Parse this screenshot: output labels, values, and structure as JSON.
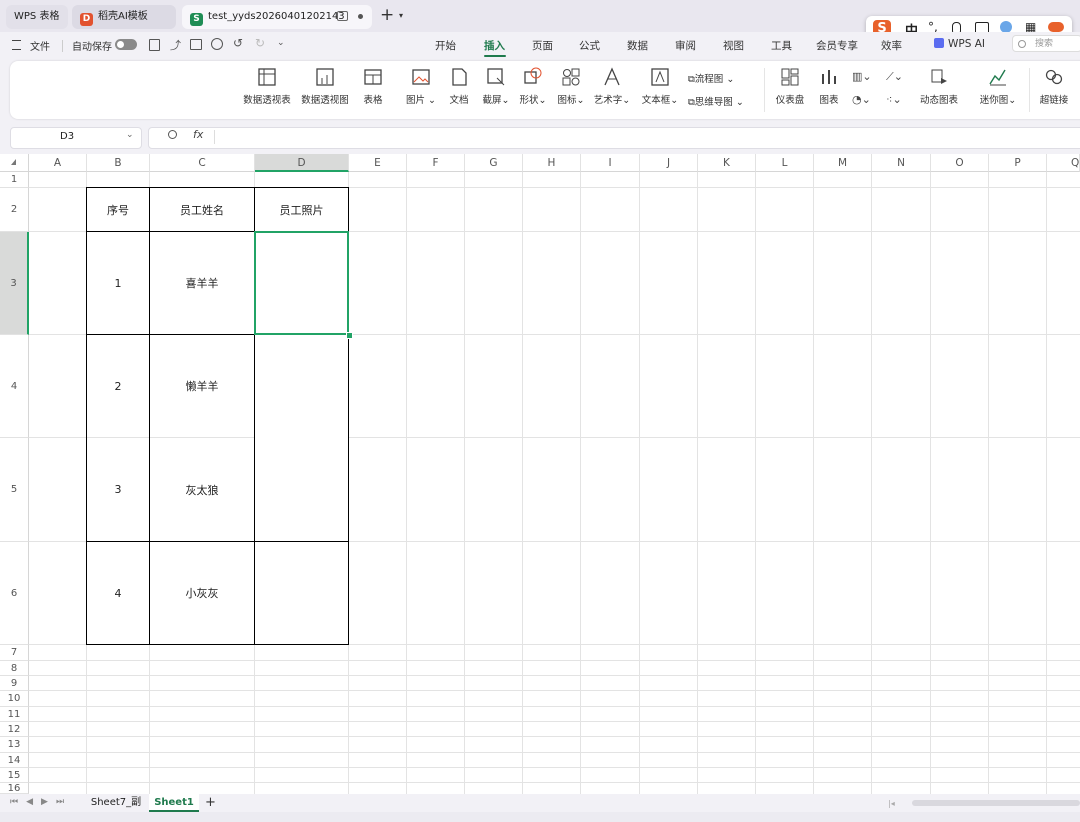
{
  "tabs": [
    {
      "label": "WPS 表格"
    },
    {
      "label": "稻壳AI模板"
    },
    {
      "label": "test_yyds20260401202143"
    }
  ],
  "menu": {
    "file": "文件",
    "autosave": "自动保存",
    "tabs": [
      "开始",
      "插入",
      "页面",
      "公式",
      "数据",
      "审阅",
      "视图",
      "工具",
      "会员专享",
      "效率",
      "WPS AI"
    ],
    "active_tab": "插入",
    "search_placeholder": "搜索"
  },
  "ribbon": {
    "pivot_table": "数据透视表",
    "pivot_chart": "数据透视图",
    "table": "表格",
    "picture": "图片",
    "document": "文档",
    "screenshot": "截屏",
    "shape": "形状",
    "icon": "图标",
    "wordart": "艺术字",
    "textbox": "文本框",
    "flowchart": "流程图",
    "mindmap": "思维导图",
    "dashboard": "仪表盘",
    "chart": "图表",
    "dynamic_chart": "动态图表",
    "sparkline": "迷你图",
    "hyperlink": "超链接"
  },
  "formula_bar": {
    "cell_ref": "D3",
    "fx": "fx",
    "value": ""
  },
  "columns": [
    "A",
    "B",
    "C",
    "D",
    "E",
    "F",
    "G",
    "H",
    "I",
    "J",
    "K",
    "L",
    "M",
    "N",
    "O",
    "P",
    "Q"
  ],
  "rows": [
    "1",
    "2",
    "3",
    "4",
    "5",
    "6",
    "7",
    "8",
    "9",
    "10",
    "11",
    "12",
    "13",
    "14",
    "15",
    "16"
  ],
  "table": {
    "headers": [
      "序号",
      "员工姓名",
      "员工照片"
    ],
    "data": [
      {
        "no": "1",
        "name": "喜羊羊"
      },
      {
        "no": "2",
        "name": "懒羊羊"
      },
      {
        "no": "3",
        "name": "灰太狼"
      },
      {
        "no": "4",
        "name": "小灰灰"
      }
    ]
  },
  "sheets": {
    "tabs": [
      "Sheet7_副",
      "Sheet1"
    ],
    "active": "Sheet1"
  },
  "ime": {
    "mode": "中"
  },
  "colors": {
    "accent": "#1f7a4d",
    "selection": "#21a366"
  }
}
